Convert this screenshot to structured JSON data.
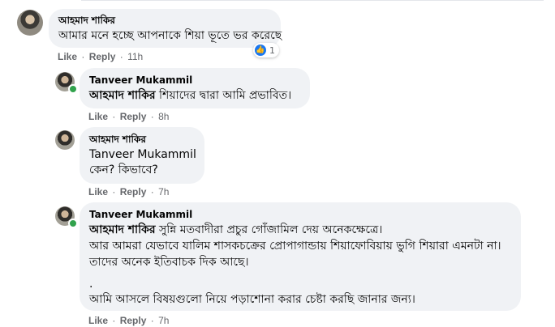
{
  "comments": [
    {
      "author": "আহমাদ শাকির",
      "lines": [
        "আমার মনে হচ্ছে আপনাকে শিয়া ভূতে ভর করেছে"
      ],
      "reaction_count": "1",
      "time": "11h"
    },
    {
      "author": "Tanveer Mukammil",
      "mention": "আহমাদ শাকির",
      "lines": [
        "শিয়াদের দ্বারা আমি প্রভাবিত।"
      ],
      "time": "8h"
    },
    {
      "author": "আহমাদ শাকির",
      "mention": "Tanveer Mukammil",
      "lines": [
        "কেন? কিভাবে?"
      ],
      "time": "7h"
    },
    {
      "author": "Tanveer Mukammil",
      "mention": "আহমাদ শাকির",
      "lines": [
        "সুন্নি মতবাদীরা প্রচুর গোঁজামিল দেয় অনেকক্ষেত্রে।",
        "আর আমরা যেভাবে যালিম শাসকচক্রের প্রোপাগান্ডায় শিয়াফোবিয়ায় ভুগি শিয়ারা এমনটা না।",
        "তাদের অনেক ইতিবাচক দিক আছে।",
        ".",
        "আমি আসলে বিষয়গুলো নিয়ে পড়াশোনা করার চেষ্টা করছি জানার জন্য।"
      ],
      "time": "7h"
    }
  ],
  "actions": {
    "like": "Like",
    "reply": "Reply",
    "separator": "·"
  }
}
